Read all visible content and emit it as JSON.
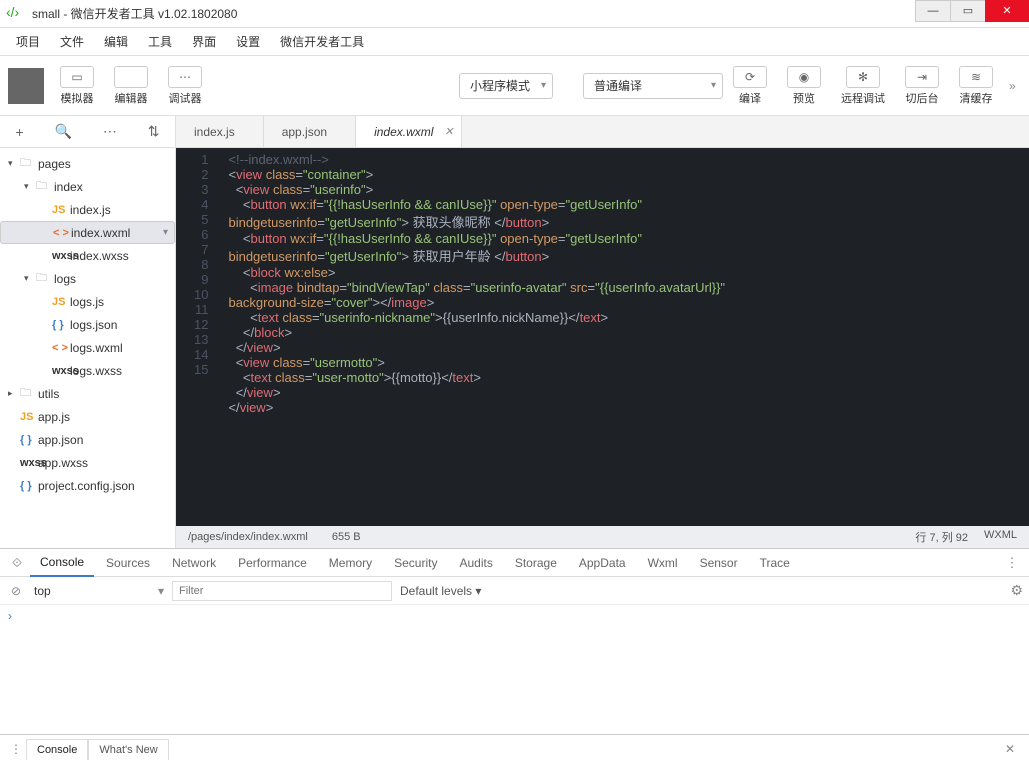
{
  "window": {
    "title": "small - 微信开发者工具 v1.02.1802080"
  },
  "menu": [
    "项目",
    "文件",
    "编辑",
    "工具",
    "界面",
    "设置",
    "微信开发者工具"
  ],
  "toolbar": {
    "buttons": [
      {
        "icon": "▭",
        "label": "模拟器"
      },
      {
        "icon": "</>",
        "label": "编辑器"
      },
      {
        "icon": "⋯",
        "label": "调试器"
      }
    ],
    "mode": "小程序模式",
    "compile": "普通编译",
    "right": [
      {
        "icon": "⟳",
        "label": "编译"
      },
      {
        "icon": "◉",
        "label": "预览"
      },
      {
        "icon": "✻",
        "label": "远程调试"
      },
      {
        "icon": "⇥",
        "label": "切后台"
      },
      {
        "icon": "≋",
        "label": "清缓存"
      }
    ]
  },
  "sidebar_icons": [
    "+",
    "🔍",
    "⋯",
    "⇅"
  ],
  "tree": [
    {
      "d": 0,
      "arr": "▾",
      "t": "folder",
      "n": "pages"
    },
    {
      "d": 1,
      "arr": "▾",
      "t": "folder",
      "n": "index"
    },
    {
      "d": 2,
      "arr": "",
      "t": "js",
      "n": "index.js"
    },
    {
      "d": 2,
      "arr": "",
      "t": "wxml",
      "n": "index.wxml",
      "sel": true
    },
    {
      "d": 2,
      "arr": "",
      "t": "wxss",
      "n": "index.wxss"
    },
    {
      "d": 1,
      "arr": "▾",
      "t": "folder",
      "n": "logs"
    },
    {
      "d": 2,
      "arr": "",
      "t": "js",
      "n": "logs.js"
    },
    {
      "d": 2,
      "arr": "",
      "t": "json",
      "n": "logs.json"
    },
    {
      "d": 2,
      "arr": "",
      "t": "wxml",
      "n": "logs.wxml"
    },
    {
      "d": 2,
      "arr": "",
      "t": "wxss",
      "n": "logs.wxss"
    },
    {
      "d": 0,
      "arr": "▸",
      "t": "folder",
      "n": "utils"
    },
    {
      "d": 0,
      "arr": "",
      "t": "js",
      "n": "app.js"
    },
    {
      "d": 0,
      "arr": "",
      "t": "json",
      "n": "app.json"
    },
    {
      "d": 0,
      "arr": "",
      "t": "wxss",
      "n": "app.wxss"
    },
    {
      "d": 0,
      "arr": "",
      "t": "json",
      "n": "project.config.json"
    }
  ],
  "tabs": [
    {
      "label": "index.js",
      "active": false
    },
    {
      "label": "app.json",
      "active": false
    },
    {
      "label": "index.wxml",
      "active": true
    }
  ],
  "code_lines": 15,
  "status": {
    "path": "/pages/index/index.wxml",
    "size": "655 B",
    "pos": "行 7, 列 92",
    "lang": "WXML"
  },
  "devtools": {
    "tabs": [
      "Console",
      "Sources",
      "Network",
      "Performance",
      "Memory",
      "Security",
      "Audits",
      "Storage",
      "AppData",
      "Wxml",
      "Sensor",
      "Trace"
    ],
    "active": "Console",
    "context": "top",
    "filter_placeholder": "Filter",
    "levels": "Default levels ▾",
    "prompt": "›"
  },
  "bottom": {
    "tabs": [
      "Console",
      "What's New"
    ],
    "active": "Console"
  }
}
